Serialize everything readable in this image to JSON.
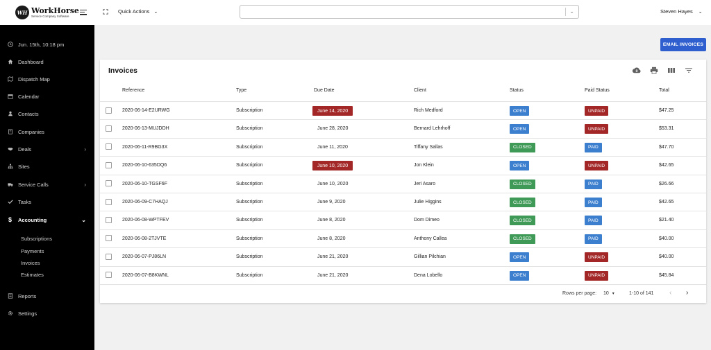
{
  "brand": {
    "logo_initials": "WH",
    "name": "WorkHorse",
    "tagline": "Service Company Software"
  },
  "sidebar": {
    "datetime": "Jun. 15th, 10:18 pm",
    "items": [
      {
        "label": "Dashboard",
        "icon": "home-icon"
      },
      {
        "label": "Dispatch Map",
        "icon": "map-icon"
      },
      {
        "label": "Calendar",
        "icon": "calendar-icon"
      },
      {
        "label": "Contacts",
        "icon": "person-icon"
      },
      {
        "label": "Companies",
        "icon": "building-icon"
      },
      {
        "label": "Deals",
        "icon": "handshake-icon"
      },
      {
        "label": "Sites",
        "icon": "sitemap-icon"
      },
      {
        "label": "Service Calls",
        "icon": "truck-icon"
      },
      {
        "label": "Tasks",
        "icon": "check-icon"
      },
      {
        "label": "Accounting",
        "icon": "dollar-icon"
      },
      {
        "label": "Reports",
        "icon": "report-icon"
      },
      {
        "label": "Settings",
        "icon": "gear-icon"
      }
    ],
    "sub_items": [
      "Subscriptions",
      "Payments",
      "Invoices",
      "Estimates"
    ]
  },
  "topbar": {
    "quick_actions": "Quick Actions",
    "search_value": "",
    "user": "Steven Hayes"
  },
  "email_button": "EMAIL INVOICES",
  "invoices": {
    "title": "Invoices",
    "columns": [
      "Reference",
      "Type",
      "Due Date",
      "Client",
      "Status",
      "Paid Status",
      "Total"
    ],
    "rows": [
      {
        "reference": "2020-06-14-E2URWG",
        "type": "Subscription",
        "due": "June 14, 2020",
        "overdue": true,
        "client": "Rich Medford",
        "status": "OPEN",
        "paid": "UNPAID",
        "total": "$47.25"
      },
      {
        "reference": "2020-06-13-MUJDDH",
        "type": "Subscription",
        "due": "June 28, 2020",
        "overdue": false,
        "client": "Bernard Lehrhoff",
        "status": "OPEN",
        "paid": "UNPAID",
        "total": "$53.31"
      },
      {
        "reference": "2020-06-11-R9BG3X",
        "type": "Subscription",
        "due": "June 11, 2020",
        "overdue": false,
        "client": "Tiffany Sallas",
        "status": "CLOSED",
        "paid": "PAID",
        "total": "$47.70"
      },
      {
        "reference": "2020-06-10-635DQ6",
        "type": "Subscription",
        "due": "June 10, 2020",
        "overdue": true,
        "client": "Jon Klein",
        "status": "OPEN",
        "paid": "UNPAID",
        "total": "$42.65"
      },
      {
        "reference": "2020-06-10-TGSF6F",
        "type": "Subscription",
        "due": "June 10, 2020",
        "overdue": false,
        "client": "Jeri Asaro",
        "status": "CLOSED",
        "paid": "PAID",
        "total": "$26.66"
      },
      {
        "reference": "2020-06-09-C7HAQJ",
        "type": "Subscription",
        "due": "June 9, 2020",
        "overdue": false,
        "client": "Julie Higgins",
        "status": "CLOSED",
        "paid": "PAID",
        "total": "$42.65"
      },
      {
        "reference": "2020-06-08-WPTFEV",
        "type": "Subscription",
        "due": "June 8, 2020",
        "overdue": false,
        "client": "Dom Dimeo",
        "status": "CLOSED",
        "paid": "PAID",
        "total": "$21.40"
      },
      {
        "reference": "2020-06-08-2TJVTE",
        "type": "Subscription",
        "due": "June 8, 2020",
        "overdue": false,
        "client": "Anthony Callea",
        "status": "CLOSED",
        "paid": "PAID",
        "total": "$40.00"
      },
      {
        "reference": "2020-06-07-PJ86LN",
        "type": "Subscription",
        "due": "June 21, 2020",
        "overdue": false,
        "client": "Gillian Pilchian",
        "status": "OPEN",
        "paid": "UNPAID",
        "total": "$40.00"
      },
      {
        "reference": "2020-06-07-B8KWNL",
        "type": "Subscription",
        "due": "June 21, 2020",
        "overdue": false,
        "client": "Dena Lobello",
        "status": "OPEN",
        "paid": "UNPAID",
        "total": "$45.84"
      }
    ],
    "footer": {
      "rows_per_page_label": "Rows per page:",
      "rows_per_page": "10",
      "range": "1-10 of 141"
    }
  },
  "colors": {
    "sidebar_bg": "#000000",
    "primary": "#2f5fcf",
    "open": "#3d7fcf",
    "closed": "#3f9a57",
    "unpaid": "#a32727"
  }
}
